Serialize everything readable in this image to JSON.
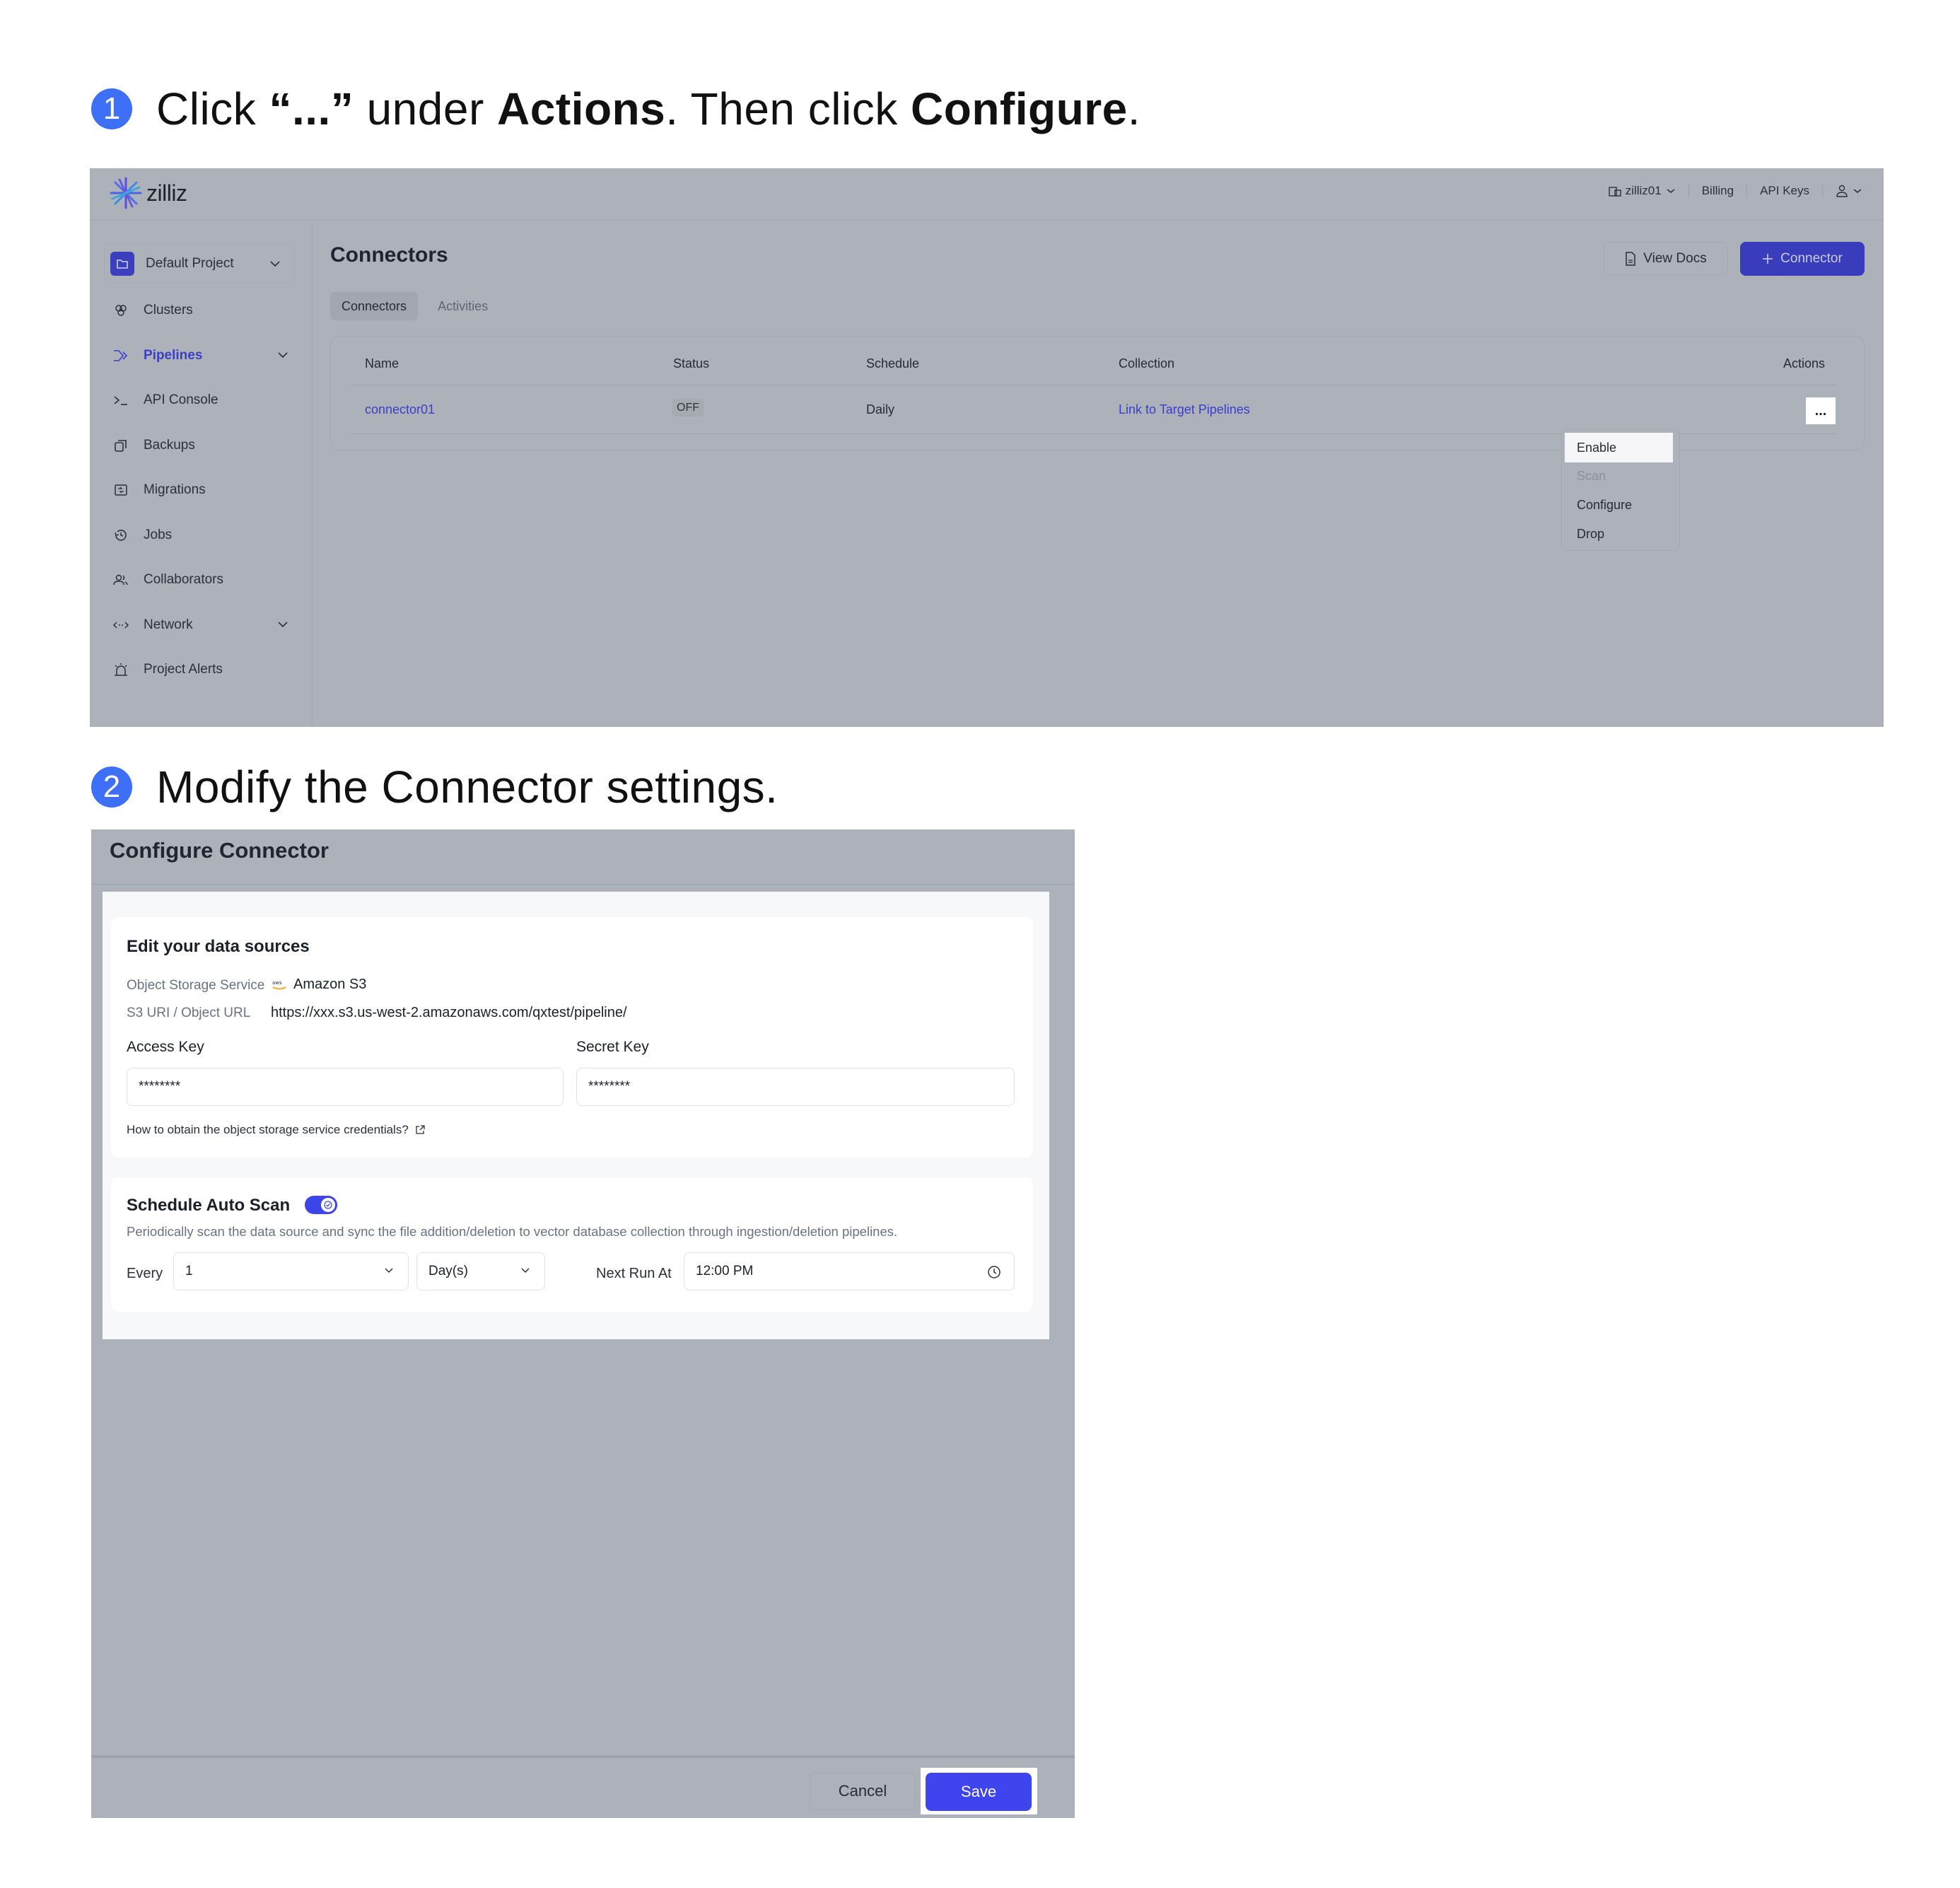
{
  "steps": [
    {
      "number": "1",
      "text_parts": [
        {
          "text": "Click ",
          "bold": false
        },
        {
          "text": "“...”",
          "bold": true
        },
        {
          "text": " under ",
          "bold": false
        },
        {
          "text": "Actions",
          "bold": true
        },
        {
          "text": ". Then click ",
          "bold": false
        },
        {
          "text": "Configure",
          "bold": true
        },
        {
          "text": ".",
          "bold": false
        }
      ]
    },
    {
      "number": "2",
      "text_parts": [
        {
          "text": "Modify the Connector settings.",
          "bold": false
        }
      ]
    }
  ],
  "screen1": {
    "logo": "zilliz",
    "topnav": {
      "org": "zilliz01",
      "billing": "Billing",
      "api_keys": "API Keys",
      "user_icon": "user-icon"
    },
    "sidebar": {
      "project": "Default Project",
      "items": [
        {
          "label": "Clusters",
          "icon": "clusters-icon",
          "active": false,
          "expandable": false
        },
        {
          "label": "Pipelines",
          "icon": "pipelines-icon",
          "active": true,
          "expandable": true
        },
        {
          "label": "API Console",
          "icon": "terminal-icon",
          "active": false,
          "expandable": false
        },
        {
          "label": "Backups",
          "icon": "backups-icon",
          "active": false,
          "expandable": false
        },
        {
          "label": "Migrations",
          "icon": "migrations-icon",
          "active": false,
          "expandable": false
        },
        {
          "label": "Jobs",
          "icon": "history-icon",
          "active": false,
          "expandable": false
        },
        {
          "label": "Collaborators",
          "icon": "users-icon",
          "active": false,
          "expandable": false
        },
        {
          "label": "Network",
          "icon": "network-icon",
          "active": false,
          "expandable": true
        },
        {
          "label": "Project Alerts",
          "icon": "alarm-icon",
          "active": false,
          "expandable": false
        }
      ]
    },
    "main": {
      "title": "Connectors",
      "view_docs": "View Docs",
      "add_connector": "+ Connector",
      "add_connector_label": "Connector",
      "tabs": [
        {
          "label": "Connectors",
          "active": true
        },
        {
          "label": "Activities",
          "active": false
        }
      ],
      "table": {
        "headers": [
          "Name",
          "Status",
          "Schedule",
          "Collection",
          "Actions"
        ],
        "rows": [
          {
            "name": "connector01",
            "status": "OFF",
            "schedule": "Daily",
            "collection": "Link to Target Pipelines",
            "actions": "..."
          }
        ]
      },
      "actions_menu": [
        {
          "label": "Enable",
          "highlighted": true,
          "disabled": false
        },
        {
          "label": "Scan",
          "highlighted": false,
          "disabled": true
        },
        {
          "label": "Configure",
          "highlighted": false,
          "disabled": false
        },
        {
          "label": "Drop",
          "highlighted": false,
          "disabled": false
        }
      ]
    }
  },
  "screen2": {
    "dialog_title": "Configure Connector",
    "data_sources": {
      "heading": "Edit your data sources",
      "object_storage_label": "Object Storage Service",
      "object_storage_value": "Amazon S3",
      "object_storage_icon": "aws-icon",
      "uri_label": "S3 URI / Object URL",
      "uri_value": "https://xxx.s3.us-west-2.amazonaws.com/qxtest/pipeline/",
      "access_key_label": "Access Key",
      "access_key_value": "********",
      "secret_key_label": "Secret Key",
      "secret_key_value": "********",
      "help_link": "How to obtain the object storage service credentials?"
    },
    "schedule": {
      "heading": "Schedule Auto Scan",
      "enabled": true,
      "description": "Periodically scan the data source and sync the file addition/deletion to vector database collection through ingestion/deletion pipelines.",
      "every_label": "Every",
      "every_value": "1",
      "unit_value": "Day(s)",
      "next_run_label": "Next Run At",
      "next_run_value": "12:00 PM"
    },
    "footer": {
      "cancel": "Cancel",
      "save": "Save"
    }
  }
}
